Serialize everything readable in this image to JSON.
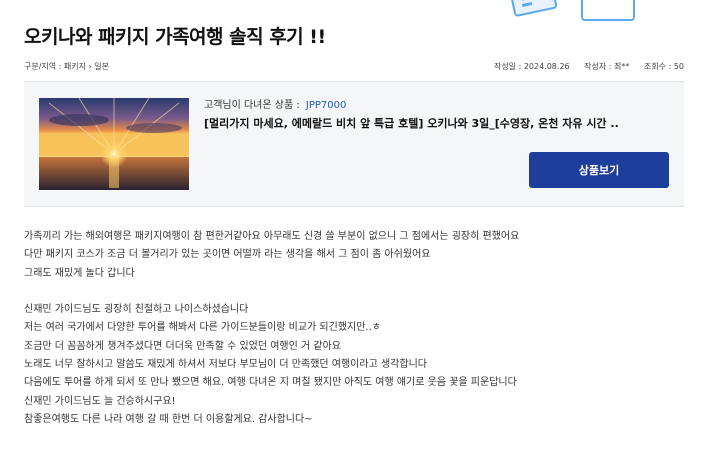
{
  "title": "오키나와 패키지 가족여행 솔직 후기 !!",
  "meta": {
    "breadcrumb_label": "구분/지역 : 패키지",
    "breadcrumb_sep": "›",
    "breadcrumb_region": "일본",
    "date": "작성일 : 2024.08.26",
    "author": "작성자 : 최**",
    "views": "조회수 : 50"
  },
  "product": {
    "customer_label": "고객님이 다녀온 상품 :",
    "code": "JPP7000",
    "name": "[멀리가지 마세요, 에메랄드 비치 앞 특급 호텔] 오키나와 3일_[수영장, 온천 자유 시간 ..",
    "button_label": "상품보기",
    "thumb_alt": "sunset-over-sea"
  },
  "review": {
    "paragraph1": [
      "가족끼리 가는 해외여행은 패키지여행이 참 편한거같아요 아무래도 신경 쓸 부분이 없으니 그 점에서는 굉장히 편했어요",
      "다만 패키지 코스가 조금 더 볼거리가 있는 곳이면 어떨까 라는 생각을 해서 그 점이 좀 아쉬웠어요",
      "그래도 재밌게 놀다 갑니다"
    ],
    "paragraph2": [
      "신재민 가이드님도 굉장히 친절하고 나이스하셨습니다",
      "저는 여러 국가에서 다양한 투어를 해봐서 다른 가이드분들이랑 비교가 되긴했지만..ㅎ",
      "조금만 더 꼼꼼하게 챙겨주셨다면 더더욱 만족할 수 있었던 여행인 거 같아요",
      "노래도 너무 잘하시고 말씀도 재밌게 하셔서 저보다 부모님이 더 만족했던 여행이라고 생각합니다",
      "다음에도 투어를 하게 되서 또 만나 뵀으면 해요. 여행 다녀온 지 며칠 됐지만 아직도 여행 얘기로 웃음 꽃을 피운답니다",
      "신재민 가이드님도 늘 건승하시구요!",
      "참좋은여행도 다른 나라 여행 갈 때 한번 더 이용할게요. 감사합니다~"
    ]
  },
  "colors": {
    "accent": "#1d3e9a",
    "code": "#1a56b8",
    "box_bg": "#f5f6f8"
  }
}
